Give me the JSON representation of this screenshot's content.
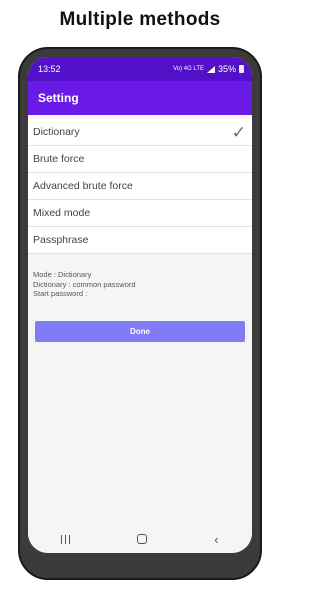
{
  "promo": {
    "title": "Multiple methods"
  },
  "status_bar": {
    "time": "13:52",
    "network": "Vo) 4G LTE",
    "battery": "35%"
  },
  "app_bar": {
    "title": "Setting"
  },
  "methods": [
    {
      "label": "Dictionary",
      "selected": true
    },
    {
      "label": "Brute force",
      "selected": false
    },
    {
      "label": "Advanced brute force",
      "selected": false
    },
    {
      "label": "Mixed mode",
      "selected": false
    },
    {
      "label": "Passphrase",
      "selected": false
    }
  ],
  "info": {
    "mode": "Mode : Dictionary",
    "dictionary": "Dictionary : common password",
    "start_password": "Start password :"
  },
  "done_button": {
    "label": "Done"
  },
  "colors": {
    "status_bar": "#5210c8",
    "app_bar": "#6a1ae6",
    "done_button": "#7f7cf5"
  },
  "icons": {
    "check": "check-icon",
    "nav_recents": "recents-icon",
    "nav_home": "home-icon",
    "nav_back": "back-icon"
  }
}
